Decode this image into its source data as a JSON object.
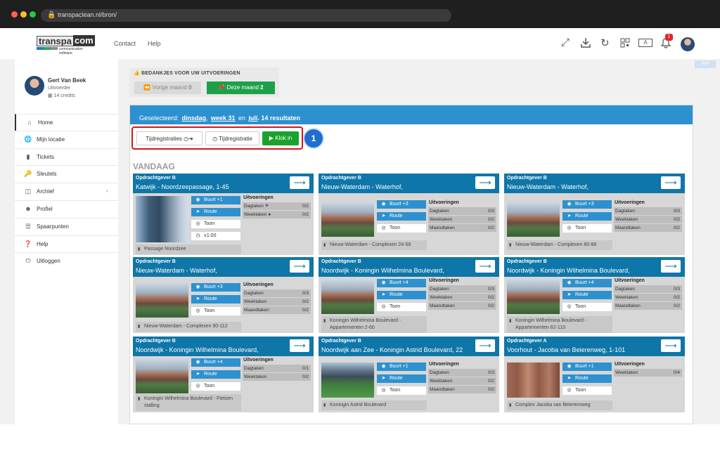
{
  "browser": {
    "url": "transpaclean.nl/bron/",
    "lock_icon": "lock-icon"
  },
  "header": {
    "logo_text": "transpa",
    "logo_accent": "com",
    "logo_sub": "communication software",
    "nav": [
      "Contact",
      "Help"
    ],
    "notification_count": "1",
    "icons": [
      "expand-icon",
      "download-icon",
      "refresh-icon",
      "qr-icon",
      "translate-icon",
      "bell-icon"
    ],
    "translate_label": "A",
    "feedback_label": "Test"
  },
  "user": {
    "name": "Gert Van Beek",
    "role": "Uitvoerder",
    "credits": "14 credits"
  },
  "sidebar": {
    "items": [
      {
        "label": "Home",
        "icon": "home-icon"
      },
      {
        "label": "Mijn locatie",
        "icon": "globe-icon"
      },
      {
        "label": "Tickets",
        "icon": "chat-icon"
      },
      {
        "label": "Sleutels",
        "icon": "key-icon"
      },
      {
        "label": "Archief",
        "icon": "archive-icon"
      },
      {
        "label": "Profiel",
        "icon": "user-icon"
      },
      {
        "label": "Spaarpunten",
        "icon": "coins-icon"
      },
      {
        "label": "Help",
        "icon": "help-icon"
      },
      {
        "label": "Uitloggen",
        "icon": "power-icon"
      }
    ]
  },
  "thanks": {
    "title": "BEDANKJES VOOR UW UITVOERINGEN",
    "prev_label": "Vorige maand",
    "prev_count": "0",
    "this_label": "Deze maand",
    "this_count": "2"
  },
  "panel": {
    "prefix": "Geselecteerd:",
    "day": "dinsdag",
    "sep1": ",",
    "week": "week 31",
    "sep2": "en",
    "month": "juli",
    "results": ". 14 resultaten"
  },
  "toolbar": {
    "registrations": "Tijdregistraties",
    "registration": "Tijdregistratie",
    "clock_in": "Klok in",
    "step": "1"
  },
  "section_title": "VANDAAG",
  "labels": {
    "uitvoeringen": "Uitvoeringen",
    "route": "Route",
    "toon": "Toon"
  },
  "cards": [
    {
      "client": "Opdrachtgever B",
      "address": "Katwijk - Noordzeepassage, 1-45",
      "buurt": "Buurt +1",
      "time": "±1:00",
      "tasks": [
        {
          "k": "Dagtaken",
          "v": "0/2"
        },
        {
          "k": "Weektaken",
          "v": "0/2"
        }
      ],
      "location": "Passage Noordzee"
    },
    {
      "client": "Opdrachtgever B",
      "address": "Nieuw-Waterdam - Waterhof,",
      "buurt": "Buurt +3",
      "tasks": [
        {
          "k": "Dagtaken",
          "v": "0/3"
        },
        {
          "k": "Weektaken",
          "v": "0/2"
        },
        {
          "k": "Maandtaken",
          "v": "0/2"
        }
      ],
      "location": "Nieuw-Waterdam - Complexen 24-58"
    },
    {
      "client": "Opdrachtgever B",
      "address": "Nieuw-Waterdam - Waterhof,",
      "buurt": "Buurt +3",
      "tasks": [
        {
          "k": "Dagtaken",
          "v": "0/3"
        },
        {
          "k": "Weektaken",
          "v": "0/2"
        },
        {
          "k": "Maandtaken",
          "v": "0/2"
        }
      ],
      "location": "Nieuw-Waterdam - Complexen 60-88"
    },
    {
      "client": "Opdrachtgever B",
      "address": "Nieuw-Waterdam - Waterhof,",
      "buurt": "Buurt +3",
      "tasks": [
        {
          "k": "Dagtaken",
          "v": "0/3"
        },
        {
          "k": "Weektaken",
          "v": "0/2"
        },
        {
          "k": "Maandtaken",
          "v": "0/2"
        }
      ],
      "location": "Nieuw-Waterdam - Complexen 90-112"
    },
    {
      "client": "Opdrachtgever B",
      "address": "Noordwijk - Koningin Wilhelmina Boulevard,",
      "buurt": "Buurt +4",
      "tasks": [
        {
          "k": "Dagtaken",
          "v": "0/3"
        },
        {
          "k": "Weektaken",
          "v": "0/2"
        },
        {
          "k": "Maandtaken",
          "v": "0/2"
        }
      ],
      "location": "Koningin Wilhelmina Boulevard - Appartementen 2-60"
    },
    {
      "client": "Opdrachtgever B",
      "address": "Noordwijk - Koningin Wilhelmina Boulevard,",
      "buurt": "Buurt +4",
      "tasks": [
        {
          "k": "Dagtaken",
          "v": "0/3"
        },
        {
          "k": "Weektaken",
          "v": "0/2"
        },
        {
          "k": "Maandtaken",
          "v": "0/2"
        }
      ],
      "location": "Koningin Wilhelmina Boulevard - Appartementen 62-110"
    },
    {
      "client": "Opdrachtgever B",
      "address": "Noordwijk - Koningin Wilhelmina Boulevard,",
      "buurt": "Buurt +4",
      "tasks": [
        {
          "k": "Dagtaken",
          "v": "0/1"
        },
        {
          "k": "Weektaken",
          "v": "0/2"
        }
      ],
      "location": "Koningin Wilhelmina Boulevard - Fietsen stalling"
    },
    {
      "client": "Opdrachtgever B",
      "address": "Noordwijk aan Zee - Koningin Astrid Boulevard, 22",
      "buurt": "Buurt +1",
      "tasks": [
        {
          "k": "Dagtaken",
          "v": "0/3"
        },
        {
          "k": "Weektaken",
          "v": "0/2"
        },
        {
          "k": "Maandtaken",
          "v": "0/2"
        }
      ],
      "location": "Koningin Astrid Boulevard"
    },
    {
      "client": "Opdrachtgever A",
      "address": "Voorhout - Jacoba van Beierenweg, 1-101",
      "buurt": "Buurt +1",
      "tasks": [
        {
          "k": "Weektaken",
          "v": "0/4"
        }
      ],
      "location": "Complex Jacoba van Beierenrweg"
    }
  ]
}
